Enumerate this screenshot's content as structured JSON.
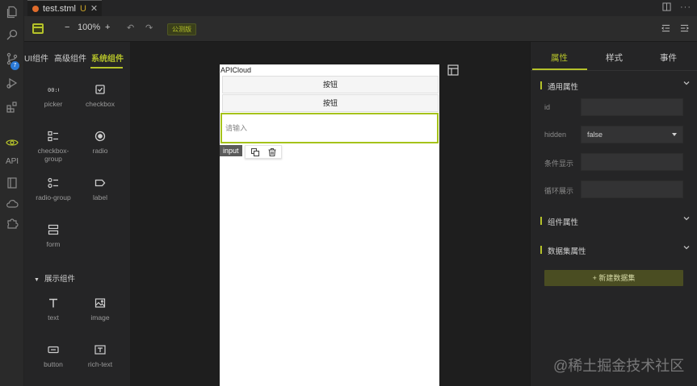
{
  "tab": {
    "title": "test.stml",
    "status": "U",
    "close": "✕"
  },
  "toolbar": {
    "minus": "−",
    "zoom": "100%",
    "plus": "+",
    "undo": "↶",
    "redo": "↷",
    "publish": "公测版"
  },
  "activity": {
    "api_label": "API",
    "badge": "7"
  },
  "left_panel": {
    "tabs": [
      "UI组件",
      "高级组件",
      "系统组件"
    ],
    "form_components": [
      {
        "label": "picker",
        "icon": "picker-icon"
      },
      {
        "label": "checkbox",
        "icon": "checkbox-icon"
      },
      {
        "label": "checkbox-group",
        "icon": "checkbox-group-icon"
      },
      {
        "label": "radio",
        "icon": "radio-icon"
      },
      {
        "label": "radio-group",
        "icon": "radio-group-icon"
      },
      {
        "label": "label",
        "icon": "label-icon"
      },
      {
        "label": "form",
        "icon": "form-icon"
      }
    ],
    "display_section": "展示组件",
    "display_components": [
      {
        "label": "text",
        "icon": "text-icon"
      },
      {
        "label": "image",
        "icon": "image-icon"
      },
      {
        "label": "button",
        "icon": "button-icon"
      },
      {
        "label": "rich-text",
        "icon": "rich-text-icon"
      }
    ]
  },
  "canvas": {
    "app_title": "APICloud",
    "button1": "按钮",
    "button2": "按钮",
    "input_placeholder": "请输入",
    "selected_tag": "input"
  },
  "right_panel": {
    "tabs": [
      "属性",
      "样式",
      "事件"
    ],
    "general_group": "通用属性",
    "props": [
      {
        "label": "id",
        "value": ""
      },
      {
        "label": "hidden",
        "value": "false"
      },
      {
        "label": "条件显示",
        "value": ""
      },
      {
        "label": "循环展示",
        "value": ""
      }
    ],
    "component_group": "组件属性",
    "dataset_group": "数据集属性",
    "new_dataset": "+ 新建数据集"
  },
  "watermark": "@稀土掘金技术社区",
  "colors": {
    "accent": "#b5c22a",
    "background": "#1e1e1e",
    "panel": "#252526"
  }
}
